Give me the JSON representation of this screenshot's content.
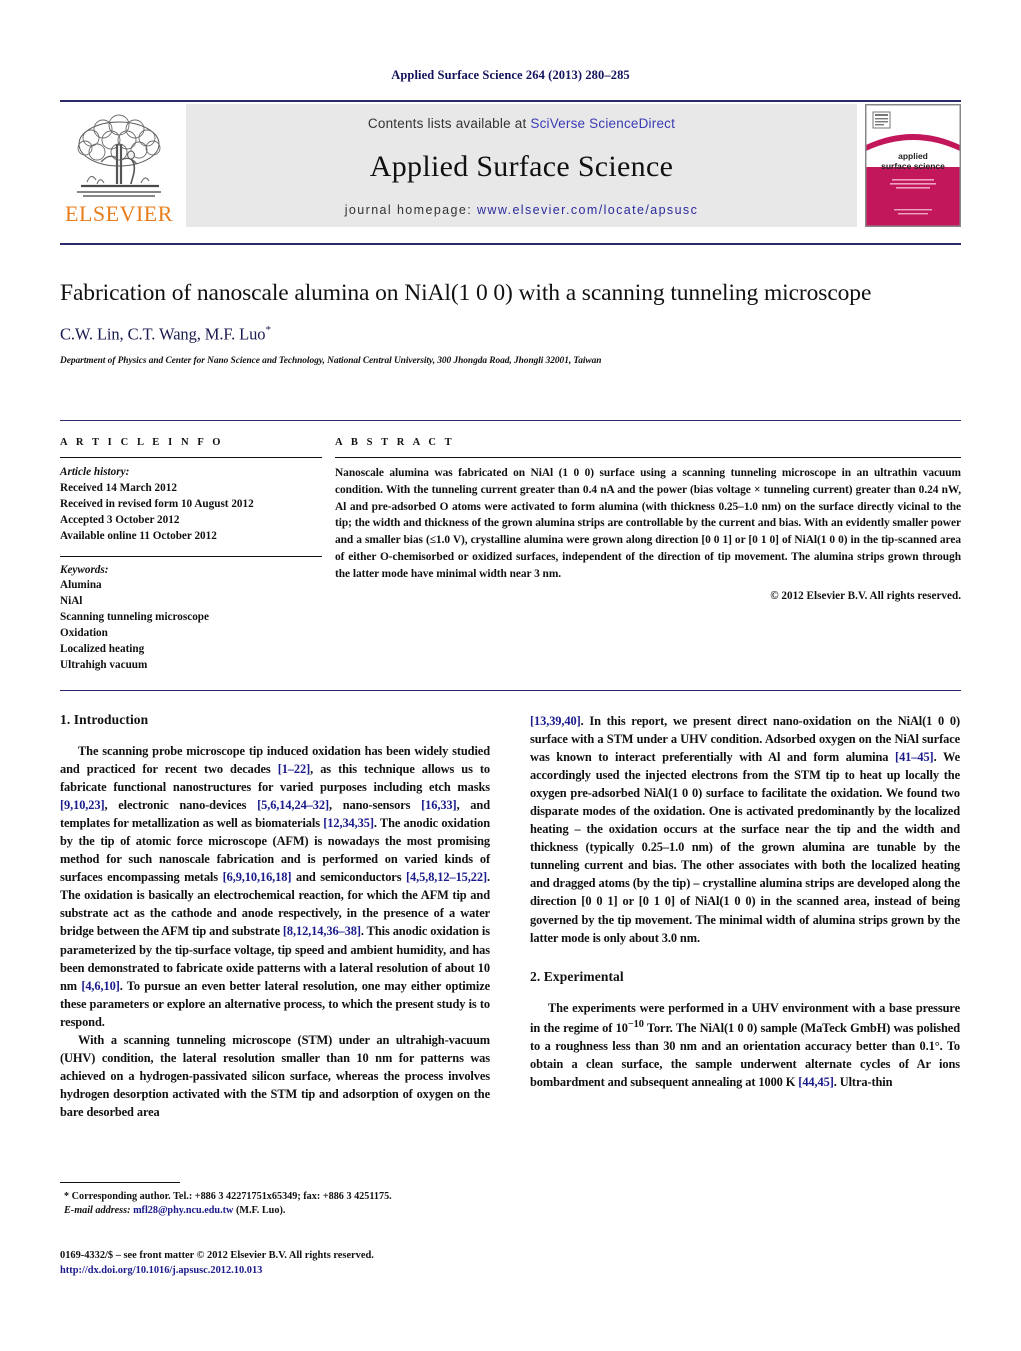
{
  "running_head": "Applied Surface Science 264 (2013) 280–285",
  "masthead": {
    "contents_prefix": "Contents lists available at ",
    "contents_link": "SciVerse ScienceDirect",
    "journal_title": "Applied Surface Science",
    "homepage_prefix": "journal homepage: ",
    "homepage_url": "www.elsevier.com/locate/apsusc",
    "publisher_logo_text": "ELSEVIER",
    "cover_title_line1": "applied",
    "cover_title_line2": "surface science"
  },
  "article": {
    "title": "Fabrication of nanoscale alumina on NiAl(1 0 0) with a scanning tunneling microscope",
    "authors": "C.W. Lin, C.T. Wang, M.F. Luo",
    "corresponding_marker": "*",
    "affiliation": "Department of Physics and Center for Nano Science and Technology, National Central University, 300 Jhongda Road, Jhongli 32001, Taiwan"
  },
  "article_info": {
    "heading": "A R T I C L E   I N F O",
    "history_label": "Article history:",
    "history": [
      "Received 14 March 2012",
      "Received in revised form 10 August 2012",
      "Accepted 3 October 2012",
      "Available online 11 October 2012"
    ],
    "keywords_label": "Keywords:",
    "keywords": [
      "Alumina",
      "NiAl",
      "Scanning tunneling microscope",
      "Oxidation",
      "Localized heating",
      "Ultrahigh vacuum"
    ]
  },
  "abstract": {
    "heading": "A B S T R A C T",
    "body": "Nanoscale alumina was fabricated on NiAl (1 0 0) surface using a scanning tunneling microscope in an ultrathin vacuum condition. With the tunneling current greater than 0.4 nA and the power (bias voltage × tunneling current) greater than 0.24 nW, Al and pre-adsorbed O atoms were activated to form alumina (with thickness 0.25–1.0 nm) on the surface directly vicinal to the tip; the width and thickness of the grown alumina strips are controllable by the current and bias. With an evidently smaller power and a smaller bias (≤1.0 V), crystalline alumina were grown along direction [0 0 1] or [0 1 0] of NiAl(1 0 0) in the tip-scanned area of either O-chemisorbed or oxidized surfaces, independent of the direction of tip movement. The alumina strips grown through the latter mode have minimal width near 3 nm.",
    "copyright": "© 2012 Elsevier B.V. All rights reserved."
  },
  "sections": {
    "introduction_heading": "1. Introduction",
    "experimental_heading": "2. Experimental",
    "intro_p1_a": "The scanning probe microscope tip induced oxidation has been widely studied and practiced for recent two decades ",
    "intro_p1_r1": "[1–22]",
    "intro_p1_b": ", as this technique allows us to fabricate functional nanostructures for varied purposes including etch masks ",
    "intro_p1_r2": "[9,10,23]",
    "intro_p1_c": ", electronic nano-devices ",
    "intro_p1_r3": "[5,6,14,24–32]",
    "intro_p1_d": ", nano-sensors ",
    "intro_p1_r4": "[16,33]",
    "intro_p1_e": ", and templates for metallization as well as biomaterials ",
    "intro_p1_r5": "[12,34,35]",
    "intro_p1_f": ". The anodic oxidation by the tip of atomic force microscope (AFM) is nowadays the most promising method for such nanoscale fabrication and is performed on varied kinds of surfaces encompassing metals ",
    "intro_p1_r6": "[6,9,10,16,18]",
    "intro_p1_g": " and semiconductors ",
    "intro_p1_r7": "[4,5,8,12–15,22]",
    "intro_p1_h": ". The oxidation is basically an electrochemical reaction, for which the AFM tip and substrate act as the cathode and anode respectively, in the presence of a water bridge between the AFM tip and substrate ",
    "intro_p1_r8": "[8,12,14,36–38]",
    "intro_p1_i": ". This anodic oxidation is parameterized by the tip-surface voltage, tip speed and ambient humidity, and has been demonstrated to fabricate oxide patterns with a lateral resolution of about 10 nm ",
    "intro_p1_r9": "[4,6,10]",
    "intro_p1_j": ". To pursue an even better lateral resolution, one may either optimize these parameters or explore an alternative process, to which the present study is to respond.",
    "intro_p2_a": "With a scanning tunneling microscope (STM) under an ultrahigh-vacuum (UHV) condition, the lateral resolution smaller than 10 nm for patterns was achieved on a hydrogen-passivated silicon surface, whereas the process involves hydrogen desorption activated with the STM tip and adsorption of oxygen on the bare desorbed area ",
    "intro_p2_r1": "[13,39,40]",
    "intro_p2_b": ". In this report, we present direct nano-oxidation on the NiAl(1 0 0) surface with a STM under a UHV condition. Adsorbed oxygen on the NiAl surface was known to interact preferentially with Al and form alumina ",
    "intro_p2_r2": "[41–45]",
    "intro_p2_c": ". We accordingly used the injected electrons from the STM tip to heat up locally the oxygen pre-adsorbed NiAl(1 0 0) surface to facilitate the oxidation. We found two disparate modes of the oxidation. One is activated predominantly by the localized heating – the oxidation occurs at the surface near the tip and the width and thickness (typically 0.25–1.0 nm) of the grown alumina are tunable by the tunneling current and bias. The other associates with both the localized heating and dragged atoms (by the tip) – crystalline alumina strips are developed along the direction [0 0 1] or [0 1 0] of NiAl(1 0 0) in the scanned area, instead of being governed by the tip movement. The minimal width of alumina strips grown by the latter mode is only about 3.0 nm.",
    "exp_p1_a": "The experiments were performed in a UHV environment with a base pressure in the regime of 10",
    "exp_p1_sup": "−10",
    "exp_p1_b": " Torr. The NiAl(1 0 0) sample (MaTeck GmbH) was polished to a roughness less than 30 nm and an orientation accuracy better than 0.1°. To obtain a clean surface, the sample underwent alternate cycles of Ar ions bombardment and subsequent annealing at 1000 K ",
    "exp_p1_r1": "[44,45]",
    "exp_p1_c": ". Ultra-thin"
  },
  "footnotes": {
    "corresponding": "* Corresponding author. Tel.: +886 3 42271751x65349; fax: +886 3 4251175.",
    "email_label": "E-mail address:",
    "email": "mfl28@phy.ncu.edu.tw",
    "email_owner": "(M.F. Luo).",
    "issn_line": "0169-4332/$ – see front matter © 2012 Elsevier B.V. All rights reserved.",
    "doi": "http://dx.doi.org/10.1016/j.apsusc.2012.10.013"
  },
  "colors": {
    "accent_blue": "#1a1a8c",
    "rule_navy": "#2b2b6b",
    "elsevier_orange": "#e87d1e",
    "cover_magenta": "#c2185b",
    "band_gray": "#e8e8e8"
  }
}
